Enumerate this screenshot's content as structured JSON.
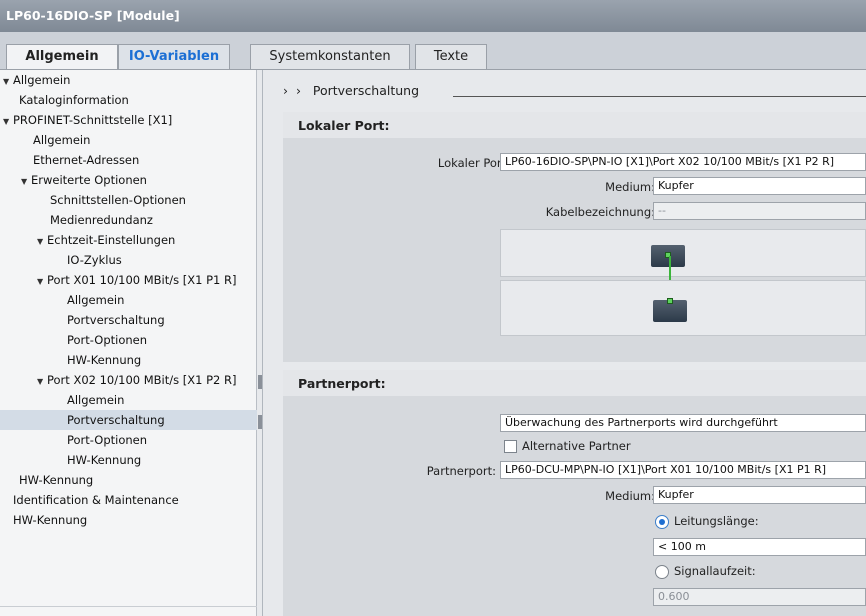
{
  "window": {
    "title": "LP60-16DIO-SP [Module]"
  },
  "tabs": [
    {
      "label": "Allgemein",
      "active": true
    },
    {
      "label": "IO-Variablen",
      "active": false
    },
    {
      "label": "Systemkonstanten",
      "active": false
    },
    {
      "label": "Texte",
      "active": false
    }
  ],
  "tree": {
    "items": [
      {
        "label": "Allgemein",
        "expanded": true
      },
      {
        "label": "Kataloginformation"
      },
      {
        "label": "PROFINET-Schnittstelle [X1]",
        "expanded": true
      },
      {
        "label": "Allgemein"
      },
      {
        "label": "Ethernet-Adressen"
      },
      {
        "label": "Erweiterte Optionen",
        "expanded": true
      },
      {
        "label": "Schnittstellen-Optionen"
      },
      {
        "label": "Medienredundanz"
      },
      {
        "label": "Echtzeit-Einstellungen",
        "expanded": true
      },
      {
        "label": "IO-Zyklus"
      },
      {
        "label": "Port X01 10/100 MBit/s [X1 P1 R]",
        "expanded": true
      },
      {
        "label": "Allgemein"
      },
      {
        "label": "Portverschaltung"
      },
      {
        "label": "Port-Optionen"
      },
      {
        "label": "HW-Kennung"
      },
      {
        "label": "Port X02 10/100 MBit/s [X1 P2 R]",
        "expanded": true
      },
      {
        "label": "Allgemein"
      },
      {
        "label": "Portverschaltung",
        "selected": true
      },
      {
        "label": "Port-Optionen"
      },
      {
        "label": "HW-Kennung"
      },
      {
        "label": "HW-Kennung"
      },
      {
        "label": "Identification & Maintenance"
      },
      {
        "label": "HW-Kennung"
      }
    ]
  },
  "main": {
    "breadcrumb": "Portverschaltung",
    "local": {
      "header": "Lokaler Port:",
      "port_label": "Lokaler Port:",
      "port_value": "LP60-16DIO-SP\\PN-IO [X1]\\Port X02 10/100 MBit/s [X1 P2 R]",
      "medium_label": "Medium:",
      "medium_value": "Kupfer",
      "cable_label": "Kabelbezeichnung:",
      "cable_value": "--"
    },
    "partner": {
      "header": "Partnerport:",
      "monitoring": "Überwachung des Partnerports wird durchgeführt",
      "alt_partner": "Alternative Partner",
      "port_label": "Partnerport:",
      "port_value": "LP60-DCU-MP\\PN-IO [X1]\\Port X01 10/100 MBit/s [X1 P1 R]",
      "medium_label": "Medium:",
      "medium_value": "Kupfer",
      "cable_length_label": "Leitungslänge:",
      "cable_length_value": "< 100 m",
      "signal_delay_label": "Signallaufzeit:",
      "signal_delay_value": "0.600"
    }
  },
  "colors": {
    "accent": "#1c6fd4",
    "link": "#3cb43c",
    "selection": "#d3dce6"
  }
}
